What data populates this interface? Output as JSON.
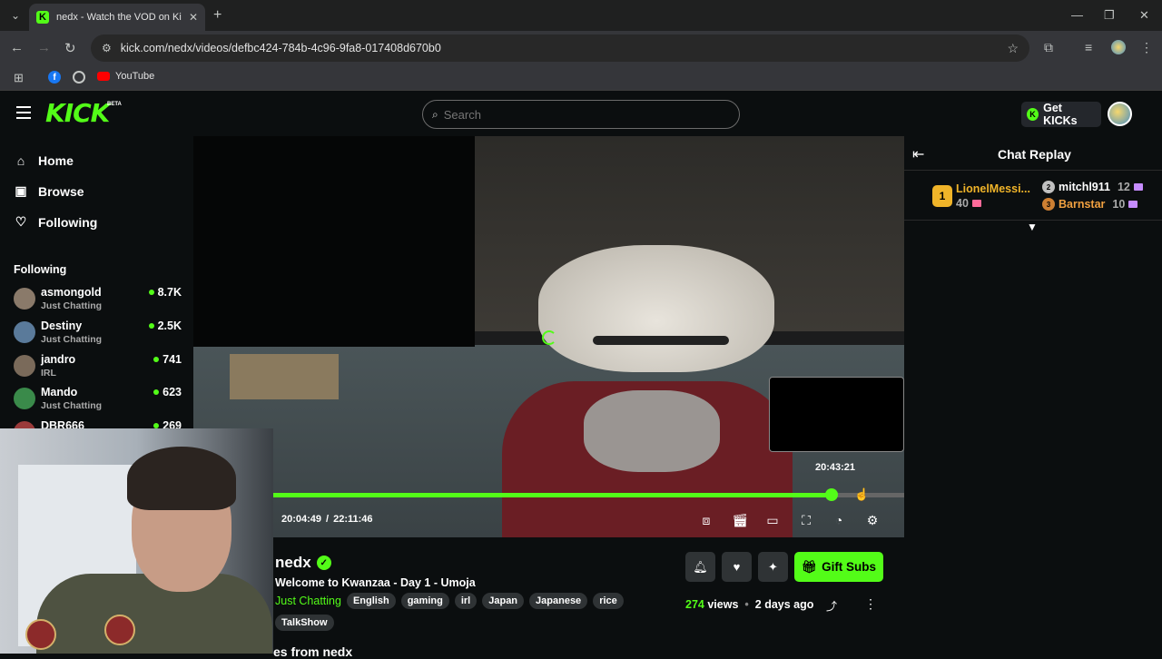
{
  "browser": {
    "tab_title": "nedx - Watch the VOD on Kick",
    "url": "kick.com/nedx/videos/defbc424-784b-4c96-9fa8-017408d670b0",
    "bookmarks": [
      {
        "label": ""
      },
      {
        "label": ""
      },
      {
        "label": "YouTube"
      }
    ]
  },
  "header": {
    "logo": "KICK",
    "beta": "BETA",
    "search_placeholder": "Search",
    "get_kicks": "Get KICKs"
  },
  "sidebar": {
    "nav": [
      {
        "label": "Home",
        "icon": "home-icon"
      },
      {
        "label": "Browse",
        "icon": "browse-icon"
      },
      {
        "label": "Following",
        "icon": "heart-icon"
      }
    ],
    "following_heading": "Following",
    "following": [
      {
        "name": "asmongold",
        "category": "Just Chatting",
        "viewers": "8.7K",
        "color": "#8a7a6a"
      },
      {
        "name": "Destiny",
        "category": "Just Chatting",
        "viewers": "2.5K",
        "color": "#5a7a9a"
      },
      {
        "name": "jandro",
        "category": "IRL",
        "viewers": "741",
        "color": "#7a6a5a"
      },
      {
        "name": "Mando",
        "category": "Just Chatting",
        "viewers": "623",
        "color": "#3a8a4a"
      },
      {
        "name": "DBR666",
        "category": "",
        "viewers": "269",
        "color": "#9a3a3a"
      }
    ]
  },
  "player": {
    "hover_time": "20:43:21",
    "current_time": "20:04:49",
    "separator": "/",
    "duration": "22:11:46",
    "progress_fraction": 0.885,
    "hover_fraction": 0.93
  },
  "chat": {
    "title": "Chat Replay",
    "top_gifters": [
      {
        "rank": "1",
        "name": "LionelMessi...",
        "count": "40"
      },
      {
        "rank": "2",
        "name": "mitchl911",
        "count": "12"
      },
      {
        "rank": "3",
        "name": "Barnstar",
        "count": "10"
      }
    ]
  },
  "stream": {
    "name": "nedx",
    "title": "Welcome to Kwanzaa - Day 1 - Umoja",
    "category": "Just Chatting",
    "tags": [
      "English",
      "gaming",
      "irl",
      "Japan",
      "Japanese",
      "rice",
      "TalkShow"
    ],
    "gift_subs": "Gift Subs",
    "views_count": "274",
    "views_label": "views",
    "bullet": "•",
    "posted": "2 days ago",
    "more_from": "es from nedx"
  },
  "colors": {
    "accent": "#53fc18",
    "background": "#0b0e0f"
  }
}
